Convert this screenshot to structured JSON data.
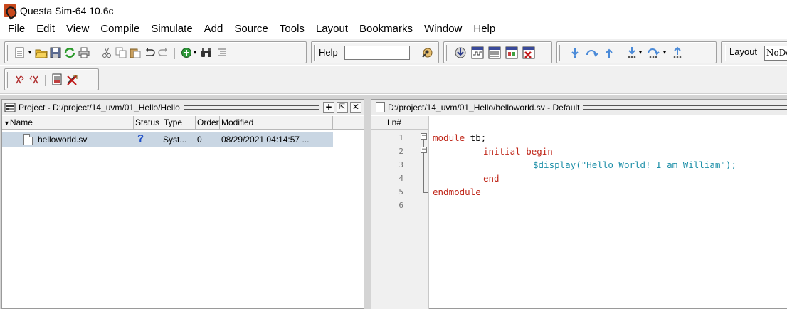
{
  "window": {
    "title": "Questa Sim-64 10.6c"
  },
  "menu": [
    "File",
    "Edit",
    "View",
    "Compile",
    "Simulate",
    "Add",
    "Source",
    "Tools",
    "Layout",
    "Bookmarks",
    "Window",
    "Help"
  ],
  "toolbar": {
    "help_label": "Help",
    "help_input_value": "",
    "layout_label": "Layout",
    "layout_value": "NoDesign"
  },
  "project_panel": {
    "title": "Project - D:/project/14_uvm/01_Hello/Hello",
    "columns": [
      "Name",
      "Status",
      "Type",
      "Order",
      "Modified"
    ],
    "rows": [
      {
        "name": "helloworld.sv",
        "status": "?",
        "type": "Syst...",
        "order": "0",
        "modified": "08/29/2021 04:14:57 ..."
      }
    ]
  },
  "editor_panel": {
    "title": "D:/project/14_uvm/01_Hello/helloworld.sv - Default",
    "ln_header": "Ln#",
    "line_numbers": [
      "1",
      "2",
      "3",
      "4",
      "5",
      "6"
    ],
    "code": {
      "l1_kw": "module",
      "l1_rest": " tb;",
      "l2_kw": "initial begin",
      "l3_sys": "$display",
      "l3_rest": "(\"Hello World! I am William\");",
      "l4_kw": "end",
      "l5_kw": "endmodule"
    }
  },
  "colors": {
    "keyword": "#c0281b",
    "system_task": "#1d8fa8",
    "selection": "#c9d6e3",
    "status_icon": "#1f4fc7"
  }
}
